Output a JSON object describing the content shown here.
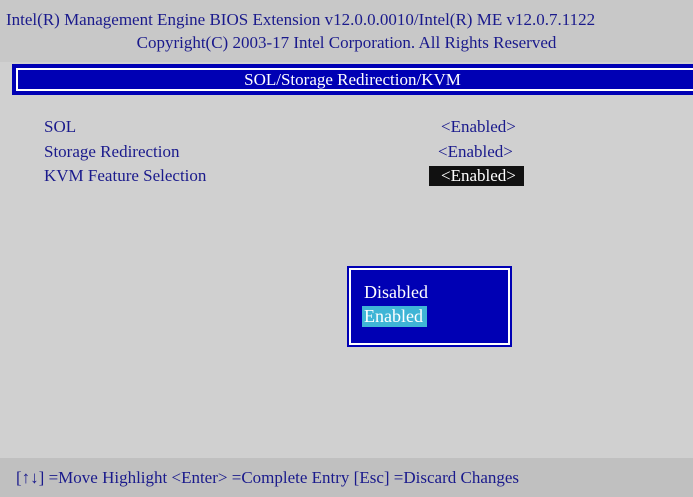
{
  "header": {
    "line1": "Intel(R) Management Engine BIOS Extension v12.0.0.0010/Intel(R) ME v12.0.7.1122",
    "line2": "Copyright(C) 2003-17 Intel Corporation. All Rights Reserved"
  },
  "screen": {
    "title": "SOL/Storage Redirection/KVM"
  },
  "settings": [
    {
      "label": "SOL",
      "value": "<Enabled>"
    },
    {
      "label": "Storage Redirection",
      "value": "<Enabled>"
    },
    {
      "label": "KVM Feature Selection",
      "value": "<Enabled>",
      "selected": true
    }
  ],
  "popup": {
    "options": [
      "Disabled",
      "Enabled"
    ],
    "selected": "Enabled"
  },
  "footer": {
    "help": "[↑↓] =Move Highlight   <Enter> =Complete Entry  [Esc] =Discard Changes"
  },
  "colors": {
    "background": "#d0d0d0",
    "text": "#1a1a8c",
    "title_bar": "#0000b4",
    "highlight": "#111111",
    "popup_selected": "#3fb5d6"
  }
}
